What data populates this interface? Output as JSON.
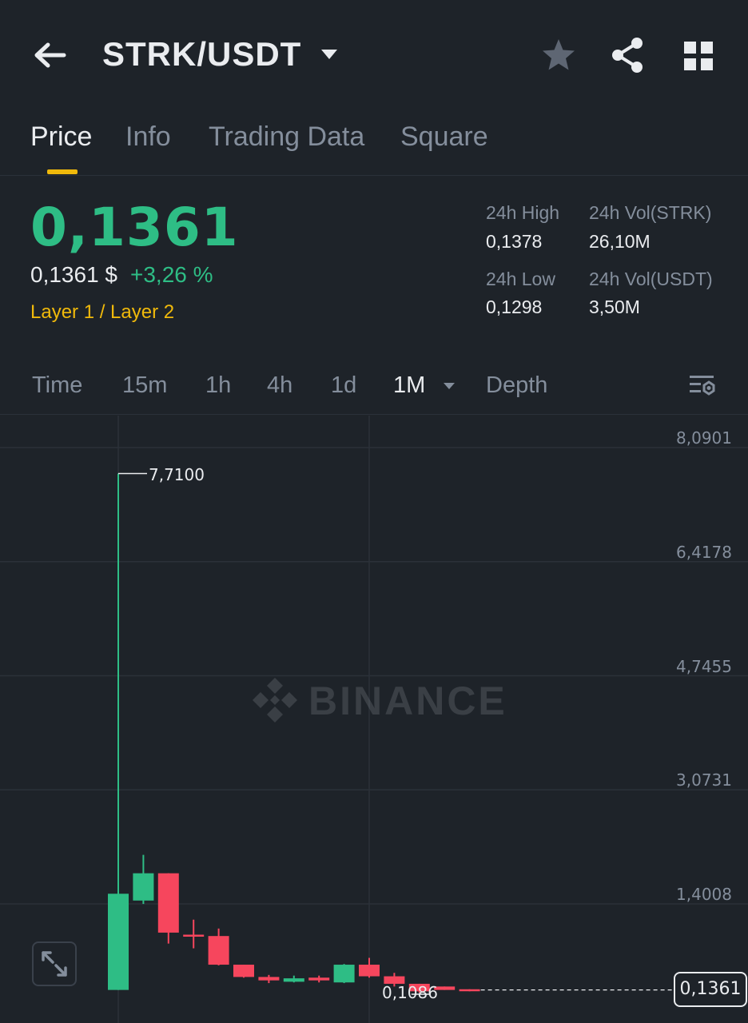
{
  "header": {
    "pair": "STRK/USDT"
  },
  "tabs": [
    "Price",
    "Info",
    "Trading Data",
    "Square"
  ],
  "price": {
    "last": "0,1361",
    "fiat": "0,1361 $",
    "change": "+3,26 %",
    "category": "Layer 1 / Layer 2"
  },
  "stats": {
    "high_label": "24h High",
    "high_value": "0,1378",
    "low_label": "24h Low",
    "low_value": "0,1298",
    "vol_base_label": "24h Vol(STRK)",
    "vol_base_value": "26,10M",
    "vol_quote_label": "24h Vol(USDT)",
    "vol_quote_value": "3,50M"
  },
  "intervals": [
    "Time",
    "15m",
    "1h",
    "4h",
    "1d",
    "1M",
    "Depth"
  ],
  "colors": {
    "up": "#2ebd85",
    "down": "#f6465d",
    "accent": "#f0b90b",
    "background": "#1e2329"
  },
  "icons": {
    "back": "arrow-left-icon",
    "caret": "caret-down-icon",
    "favorite": "star-icon",
    "share": "share-icon",
    "more": "grid-icon",
    "chart_settings": "chart-settings-icon",
    "expand": "expand-icon"
  },
  "chart": {
    "watermark": "BINANCE",
    "axis_labels": [
      "8,0901",
      "6,4178",
      "4,7455",
      "3,0731",
      "1,4008"
    ],
    "high_annotation": "7,7100",
    "low_annotation": "0,1086",
    "current_price": "0,1361"
  },
  "chart_data": {
    "type": "candlestick",
    "interval": "1M",
    "y_ticks": [
      8.0901,
      6.4178,
      4.7455,
      3.0731,
      1.4008
    ],
    "candles": [
      {
        "o": 0.14,
        "h": 7.71,
        "l": 0.14,
        "c": 1.55
      },
      {
        "o": 1.45,
        "h": 2.12,
        "l": 1.4,
        "c": 1.85
      },
      {
        "o": 1.85,
        "h": 1.85,
        "l": 0.82,
        "c": 0.98
      },
      {
        "o": 0.95,
        "h": 1.17,
        "l": 0.75,
        "c": 0.93
      },
      {
        "o": 0.93,
        "h": 1.04,
        "l": 0.5,
        "c": 0.51
      },
      {
        "o": 0.51,
        "h": 0.51,
        "l": 0.32,
        "c": 0.33
      },
      {
        "o": 0.33,
        "h": 0.36,
        "l": 0.24,
        "c": 0.28
      },
      {
        "o": 0.26,
        "h": 0.35,
        "l": 0.25,
        "c": 0.31
      },
      {
        "o": 0.32,
        "h": 0.35,
        "l": 0.25,
        "c": 0.28
      },
      {
        "o": 0.25,
        "h": 0.52,
        "l": 0.24,
        "c": 0.51
      },
      {
        "o": 0.51,
        "h": 0.61,
        "l": 0.32,
        "c": 0.34
      },
      {
        "o": 0.34,
        "h": 0.39,
        "l": 0.19,
        "c": 0.23
      },
      {
        "o": 0.23,
        "h": 0.23,
        "l": 0.1,
        "c": 0.12
      },
      {
        "o": 0.19,
        "h": 0.19,
        "l": 0.14,
        "c": 0.14
      },
      {
        "o": 0.15,
        "h": 0.15,
        "l": 0.12,
        "c": 0.14
      }
    ]
  }
}
